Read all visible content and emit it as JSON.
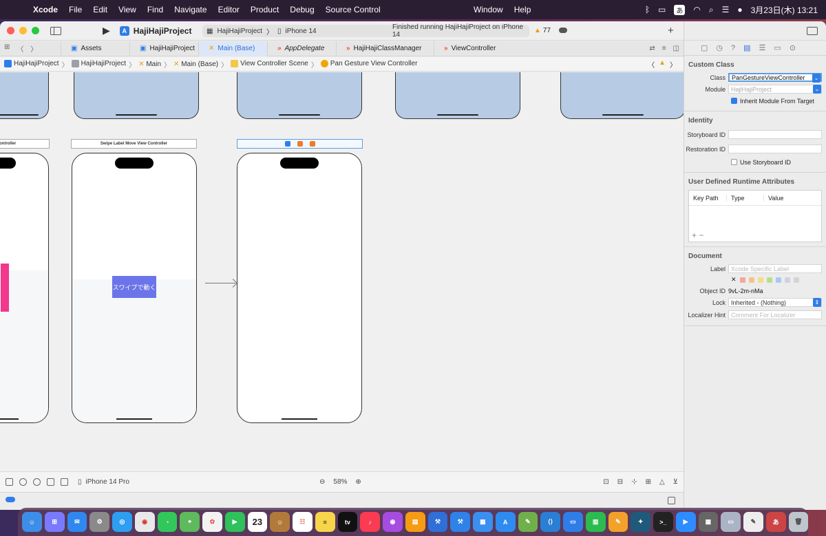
{
  "menubar": {
    "app": "Xcode",
    "items": [
      "File",
      "Edit",
      "View",
      "Find",
      "Navigate",
      "Editor",
      "Product",
      "Debug",
      "Source Control"
    ],
    "center_items": [
      "Window",
      "Help"
    ],
    "input_mode": "あ",
    "datetime": "3月23日(木)  13:21"
  },
  "toolbar": {
    "project": "HajiHajiProject",
    "scheme": "HajiHajiProject",
    "device": "iPhone 14",
    "status": "Finished running HajiHajiProject on iPhone 14",
    "warnings": "77"
  },
  "tabs": [
    {
      "label": "Assets",
      "kind": "assets"
    },
    {
      "label": "HajiHajiProject",
      "kind": "project"
    },
    {
      "label": "Main (Base)",
      "kind": "storyboard",
      "active": true
    },
    {
      "label": "AppDelegate",
      "kind": "swift",
      "italic": true
    },
    {
      "label": "HajiHajiClassManager",
      "kind": "swift"
    },
    {
      "label": "ViewController",
      "kind": "swift"
    }
  ],
  "breadcrumb": [
    "HajiHajiProject",
    "HajiHajiProject",
    "Main",
    "Main (Base)",
    "View Controller Scene",
    "Pan Gesture View Controller"
  ],
  "canvas": {
    "scene_titles": [
      "ontroller",
      "Swipe Label Move View Controller"
    ],
    "swipe_label": "スワイプで動く"
  },
  "bottombar": {
    "device": "iPhone 14 Pro",
    "zoom": "58%"
  },
  "inspector": {
    "custom_class": {
      "heading": "Custom Class",
      "class_label": "Class",
      "class_value": "PanGestureViewController",
      "module_label": "Module",
      "module_placeholder": "HajiHajiProject",
      "inherit_label": "Inherit Module From Target"
    },
    "identity": {
      "heading": "Identity",
      "storyboard_id_label": "Storyboard ID",
      "restoration_id_label": "Restoration ID",
      "use_storyboard_id_label": "Use Storyboard ID"
    },
    "udra": {
      "heading": "User Defined Runtime Attributes",
      "columns": [
        "Key Path",
        "Type",
        "Value"
      ]
    },
    "document": {
      "heading": "Document",
      "label_label": "Label",
      "label_placeholder": "Xcode Specific Label",
      "object_id_label": "Object ID",
      "object_id": "9vL-2m-nMa",
      "lock_label": "Lock",
      "lock_value": "Inherited - (Nothing)",
      "localizer_label": "Localizer Hint",
      "localizer_placeholder": "Comment For Localizer"
    }
  },
  "dock": {
    "calendar_day": "23",
    "tv_label": "tv"
  },
  "colors": {
    "accent": "#2f7ee8",
    "swipe_label_bg": "#6b74e8",
    "pink": "#f2378c",
    "scene_top": "#b7cbe5"
  }
}
